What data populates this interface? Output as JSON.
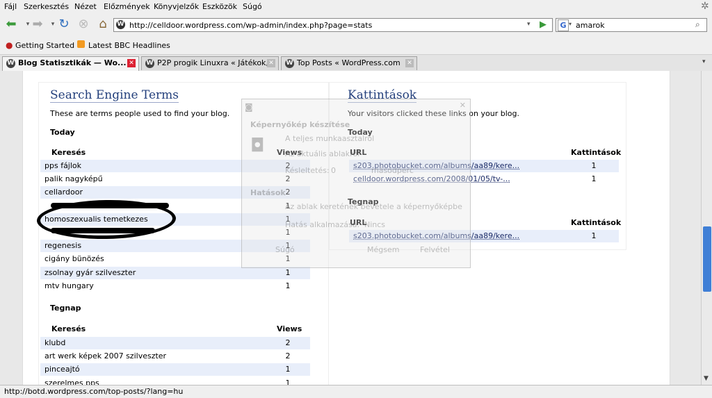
{
  "menu": [
    "Fájl",
    "Szerkesztés",
    "Nézet",
    "Előzmények",
    "Könyvjelzők",
    "Eszközök",
    "Súgó"
  ],
  "nav": {
    "url": "http://celldoor.wordpress.com/wp-admin/index.php?page=stats",
    "search_value": "amarok"
  },
  "bookmarks": [
    "Getting Started",
    "Latest BBC Headlines"
  ],
  "tabs": [
    "Blog Statisztikák — Wo...",
    "P2P progik Linuxra « Játékok,...",
    "Top Posts « WordPress.com"
  ],
  "search_terms": {
    "title": "Search Engine Terms",
    "description": "These are terms people used to find your blog.",
    "today_label": "Today",
    "col_term": "Keresés",
    "col_views": "Views",
    "today_rows": [
      {
        "term": "pps fájlok",
        "views": "2"
      },
      {
        "term": "palik nagyképű",
        "views": "2"
      },
      {
        "term": "cellardoor",
        "views": "2"
      },
      {
        "term": "",
        "views": "1"
      },
      {
        "term": "homoszexualis temetkezes",
        "views": "1"
      },
      {
        "term": "",
        "views": "1"
      },
      {
        "term": "regenesis",
        "views": "1"
      },
      {
        "term": "cigány bünözés",
        "views": "1"
      },
      {
        "term": "zsolnay gyár szilveszter",
        "views": "1"
      },
      {
        "term": "mtv hungary",
        "views": "1"
      }
    ],
    "yesterday_label": "Tegnap",
    "yesterday_rows": [
      {
        "term": "klubd",
        "views": "2"
      },
      {
        "term": "art werk képek 2007 szilveszter",
        "views": "2"
      },
      {
        "term": "pinceajtó",
        "views": "1"
      },
      {
        "term": "szerelmes pps",
        "views": "1"
      }
    ]
  },
  "clicks": {
    "title": "Kattintások",
    "description": "Your visitors clicked these links on your blog.",
    "today_label": "Today",
    "col_url": "URL",
    "col_clicks": "Kattintások",
    "today_rows": [
      {
        "url": "s203.photobucket.com/albums/aa89/kere...",
        "clicks": "1"
      },
      {
        "url": "celldoor.wordpress.com/2008/01/05/tv-...",
        "clicks": "1"
      }
    ],
    "yesterday_label": "Tegnap",
    "yesterday_rows": [
      {
        "url": "s203.photobucket.com/albums/aa89/kere...",
        "clicks": "1"
      }
    ]
  },
  "dialog": {
    "title": "Képernyőkép készítése",
    "opt1": "A teljes munkaasztalról",
    "opt2": "Az aktuális ablakról",
    "delay_label": "Késleltetés:",
    "delay_value": "0",
    "delay_unit": "másodperc",
    "effects_label": "Hatások",
    "include_border": "Az ablak keretének bevétele a képernyőképbe",
    "apply_effect_label": "Hatás alkalmazása:",
    "effect_value": "Nincs",
    "help": "Súgó",
    "cancel": "Mégsem",
    "save": "Felvétel"
  },
  "status": "http://botd.wordpress.com/top-posts/?lang=hu",
  "colors": {
    "accent": "#24407c",
    "row_alt": "#e8eefa",
    "scrollbar_thumb": "#3f7fd6"
  }
}
